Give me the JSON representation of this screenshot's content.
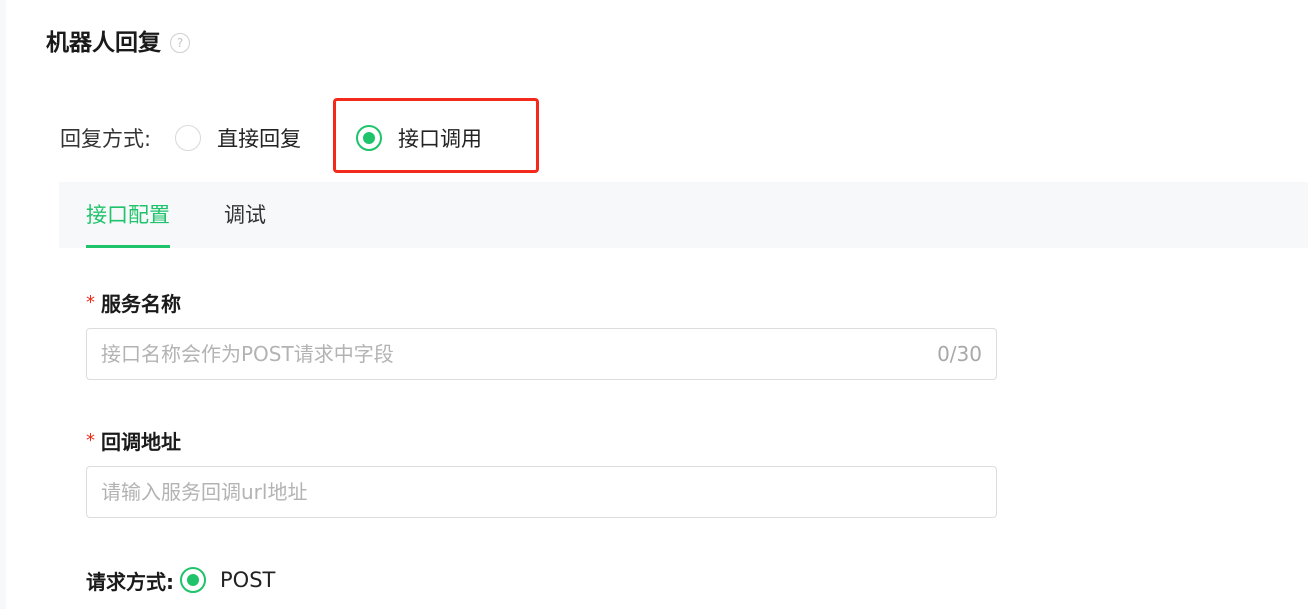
{
  "section": {
    "title": "机器人回复",
    "help_icon": "?"
  },
  "reply_mode": {
    "label": "回复方式:",
    "options": [
      {
        "label": "直接回复",
        "selected": false
      },
      {
        "label": "接口调用",
        "selected": true
      }
    ]
  },
  "tabs": [
    {
      "label": "接口配置",
      "active": true
    },
    {
      "label": "调试",
      "active": false
    }
  ],
  "form": {
    "service_name": {
      "required_mark": "*",
      "label": "服务名称",
      "placeholder": "接口名称会作为POST请求中字段",
      "value": "",
      "char_count": "0/30"
    },
    "callback_url": {
      "required_mark": "*",
      "label": "回调地址",
      "placeholder": "请输入服务回调url地址",
      "value": ""
    },
    "request_method": {
      "label": "请求方式:",
      "option": "POST",
      "selected": true
    }
  },
  "colors": {
    "accent": "#1ec36a",
    "highlight_border": "#f2291b",
    "required": "#f2291b"
  }
}
